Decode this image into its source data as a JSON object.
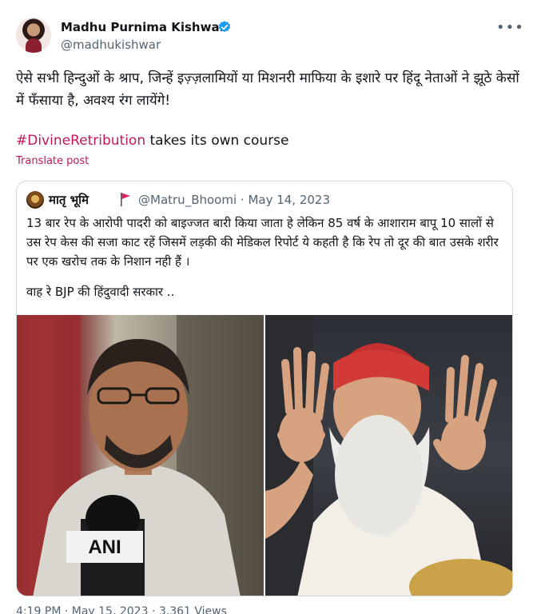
{
  "author": {
    "name": "Madhu Purnima Kishwar",
    "handle": "@madhukishwar"
  },
  "tweet": {
    "text": "ऐसे सभी हिन्दुओं के श्राप, जिन्हें इज़्ज़लामियों या मिशनरी माफिया के इशारे पर हिंदू नेताओं ने झूठे केसों में फँसाया है, अवश्य रंग लायेंगे!",
    "hashtag": "#DivineRetribution",
    "hashtag_rest": " takes its own course",
    "translate_label": "Translate post"
  },
  "quoted": {
    "name": "मातृ भूमि",
    "handle": "@Matru_Bhoomi",
    "separator": " · ",
    "date": "May 14, 2023",
    "text": "13 बार रेप के आरोपी पादरी को बाइज्जत बारी किया जाता हे लेकिन 85 वर्ष के आशाराम बापू 10 सालों से उस रेप केस की सजा काट रहें जिसमें लड़की की मेडिकल रिपोर्ट ये कहती है कि रेप तो दूर की बात उसके शरीर पर एक खरोच तक के निशान नही हैं ।",
    "text2": "वाह रे BJP की हिंदुवादी सरकार ..",
    "mic_logo": "ANI"
  },
  "footer": {
    "partial_text": "4:19 PM · May 15, 2023 · 3,361 Views"
  },
  "colors": {
    "accent": "#c2185b",
    "secondary_text": "#536471",
    "border": "#cfd9de",
    "verified_badge": "#1d9bf0"
  },
  "icons": [
    "verified-badge-icon",
    "more-options-icon",
    "red-flag-icon"
  ]
}
